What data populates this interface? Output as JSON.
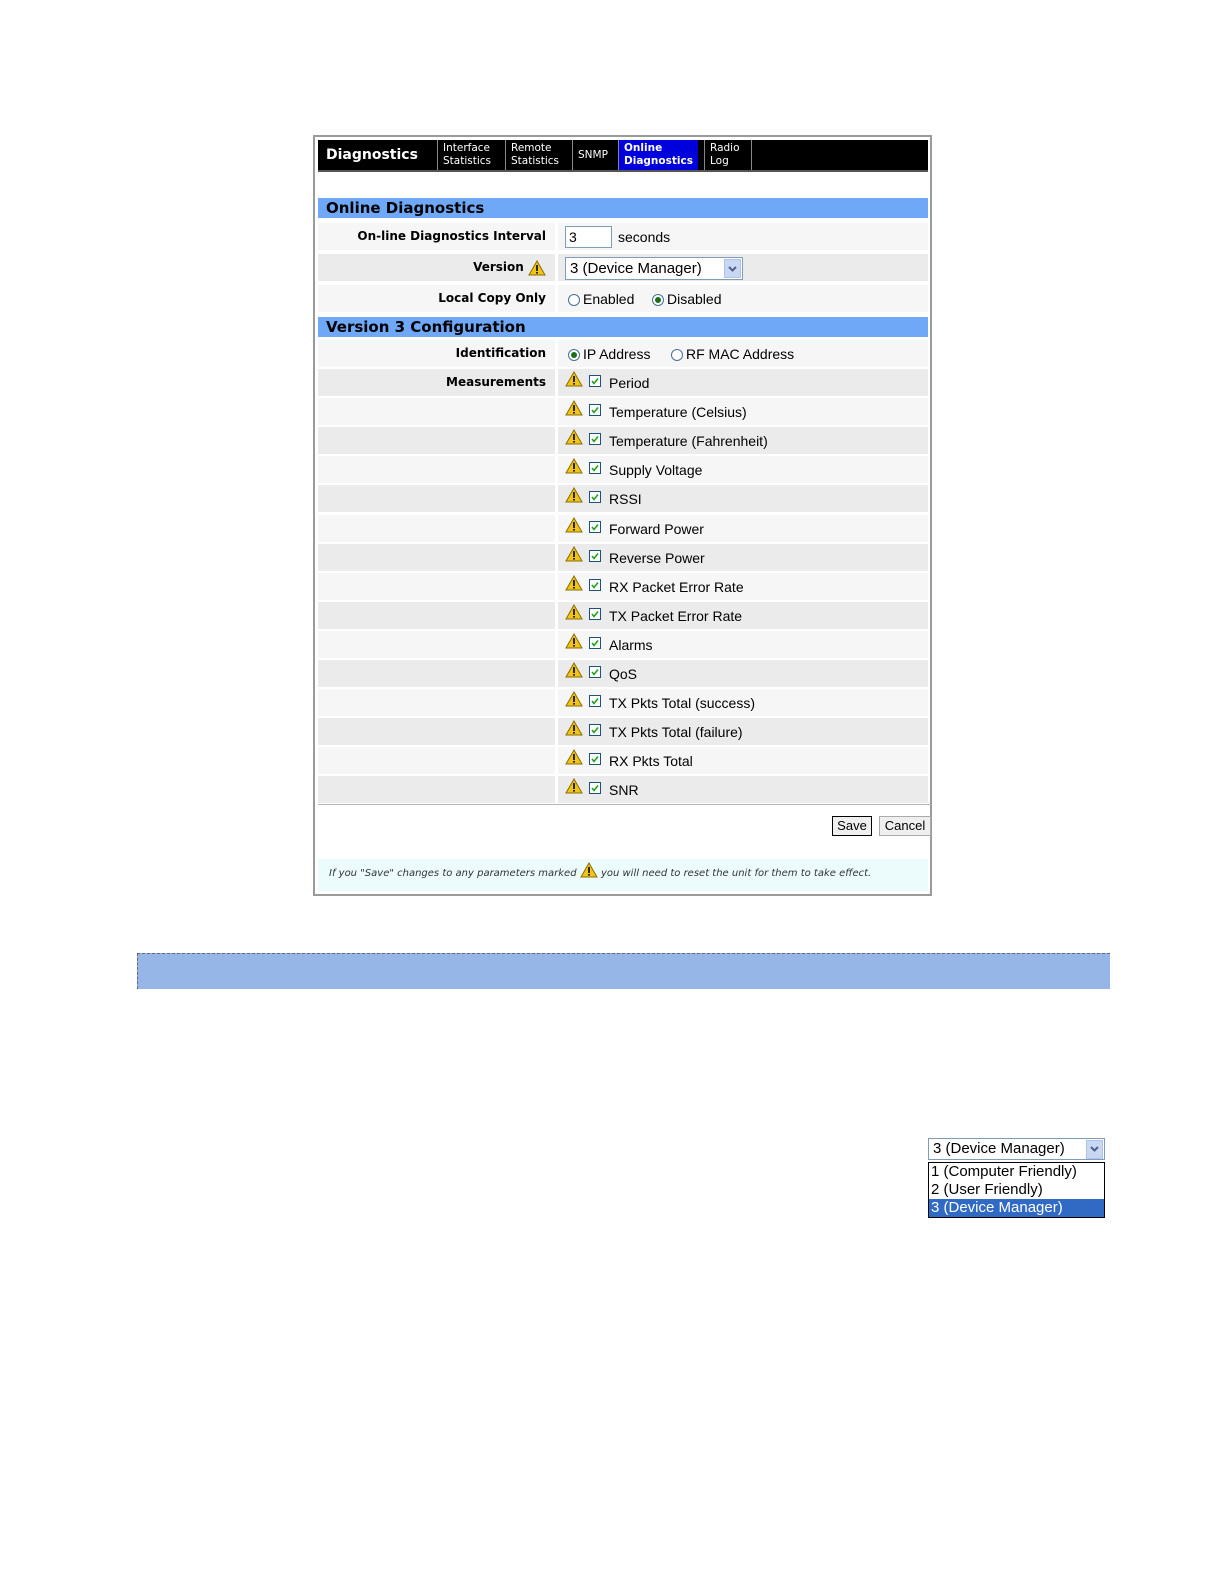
{
  "nav": {
    "brand": "Diagnostics",
    "tabs": [
      {
        "line1": "Interface",
        "line2": "Statistics"
      },
      {
        "line1": "Remote",
        "line2": "Statistics"
      },
      {
        "line1": "SNMP",
        "line2": ""
      },
      {
        "line1": "Online",
        "line2": "Diagnostics"
      },
      {
        "line1": "Radio",
        "line2": "Log"
      }
    ]
  },
  "online_diag": {
    "title": "Online Diagnostics",
    "interval_label": "On-line Diagnostics Interval",
    "interval_value": "3",
    "interval_unit": "seconds",
    "version_label": "Version",
    "version_value": "3 (Device Manager)",
    "local_copy_label": "Local Copy Only",
    "local_copy_enabled": "Enabled",
    "local_copy_disabled": "Disabled"
  },
  "v3": {
    "title": "Version 3 Configuration",
    "ident_label": "Identification",
    "ident_ip": "IP Address",
    "ident_mac": "RF MAC Address",
    "measurements_label": "Measurements",
    "measurements": [
      "Period",
      "Temperature (Celsius)",
      "Temperature (Fahrenheit)",
      "Supply Voltage",
      "RSSI",
      "Forward Power",
      "Reverse Power",
      "RX Packet Error Rate",
      "TX Packet Error Rate",
      "Alarms",
      "QoS",
      "TX Pkts Total (success)",
      "TX Pkts Total (failure)",
      "RX Pkts Total",
      "SNR"
    ]
  },
  "buttons": {
    "save": "Save",
    "cancel": "Cancel"
  },
  "footnote": {
    "part1": "If you \"Save\" changes to any parameters marked",
    "part2": "you will need to reset the unit for them to take effect."
  },
  "version_dropdown": {
    "selected": "3 (Device Manager)",
    "options": [
      "1 (Computer Friendly)",
      "2 (User Friendly)",
      "3 (Device Manager)"
    ]
  },
  "colors": {
    "nav_active": "#0000dd",
    "section_header": "#6fa8f7",
    "warning": "#f0c419",
    "highlight": "#316ac5"
  }
}
